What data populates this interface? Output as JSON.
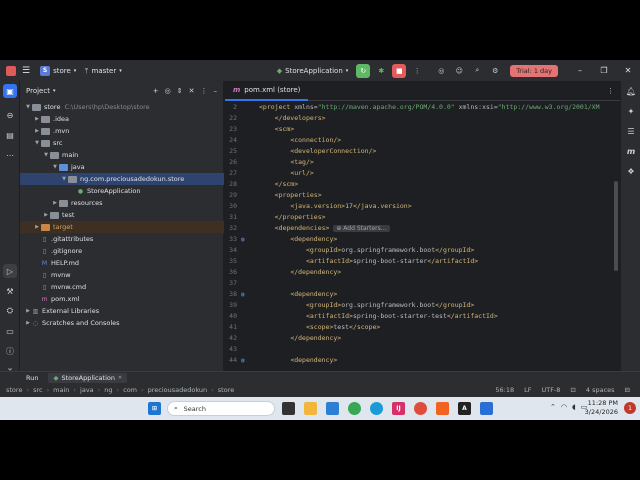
{
  "titlebar": {
    "project_badge": "S",
    "project_name": "store",
    "branch": "master",
    "run_config": "StoreApplication",
    "trial_label": "Trial: 1 day"
  },
  "project_panel": {
    "title": "Project",
    "tree": [
      {
        "label": "store",
        "extra": "C:\\Users\\hp\\Desktop\\store",
        "depth": 0,
        "arrow": "open",
        "icon": "folder"
      },
      {
        "label": ".idea",
        "depth": 1,
        "arrow": "closed",
        "icon": "folder"
      },
      {
        "label": ".mvn",
        "depth": 1,
        "arrow": "closed",
        "icon": "folder"
      },
      {
        "label": "src",
        "depth": 1,
        "arrow": "open",
        "icon": "folder"
      },
      {
        "label": "main",
        "depth": 2,
        "arrow": "open",
        "icon": "folder"
      },
      {
        "label": "java",
        "depth": 3,
        "arrow": "open",
        "icon": "folder-blue"
      },
      {
        "label": "ng.com.preciousadedokun.store",
        "depth": 4,
        "arrow": "open",
        "icon": "folder",
        "selected": true
      },
      {
        "label": "StoreApplication",
        "depth": 5,
        "arrow": "",
        "icon": "class"
      },
      {
        "label": "resources",
        "depth": 3,
        "arrow": "closed",
        "icon": "folder"
      },
      {
        "label": "test",
        "depth": 2,
        "arrow": "closed",
        "icon": "folder"
      },
      {
        "label": "target",
        "depth": 1,
        "arrow": "closed",
        "icon": "folder-orange",
        "excluded": true
      },
      {
        "label": ".gitattributes",
        "depth": 1,
        "arrow": "",
        "icon": "file"
      },
      {
        "label": ".gitignore",
        "depth": 1,
        "arrow": "",
        "icon": "file"
      },
      {
        "label": "HELP.md",
        "depth": 1,
        "arrow": "",
        "icon": "md"
      },
      {
        "label": "mvnw",
        "depth": 1,
        "arrow": "",
        "icon": "file"
      },
      {
        "label": "mvnw.cmd",
        "depth": 1,
        "arrow": "",
        "icon": "file"
      },
      {
        "label": "pom.xml",
        "depth": 1,
        "arrow": "",
        "icon": "maven"
      },
      {
        "label": "External Libraries",
        "depth": 0,
        "arrow": "closed",
        "icon": "lib"
      },
      {
        "label": "Scratches and Consoles",
        "depth": 0,
        "arrow": "closed",
        "icon": "scratch"
      }
    ]
  },
  "editor": {
    "tab_prefix": "m",
    "tab_label": "pom.xml (store)",
    "lines": [
      {
        "n": "2",
        "html": "<span class='tag'>&lt;project</span> <span class='attr'>xmlns=</span><span class='val'>\"http://maven.apache.org/POM/4.0.0\"</span> <span class='attr'>xmlns:xsi=</span><span class='val'>\"http://www.w3.org/2001/XM</span>"
      },
      {
        "n": "22",
        "html": "    <span class='tag'>&lt;/developers&gt;</span>"
      },
      {
        "n": "23",
        "html": "    <span class='tag'>&lt;scm&gt;</span>"
      },
      {
        "n": "24",
        "html": "        <span class='tag'>&lt;connection/&gt;</span>"
      },
      {
        "n": "25",
        "html": "        <span class='tag'>&lt;developerConnection/&gt;</span>"
      },
      {
        "n": "26",
        "html": "        <span class='tag'>&lt;tag/&gt;</span>"
      },
      {
        "n": "27",
        "html": "        <span class='tag'>&lt;url/&gt;</span>"
      },
      {
        "n": "28",
        "html": "    <span class='tag'>&lt;/scm&gt;</span>"
      },
      {
        "n": "29",
        "html": "    <span class='tag'>&lt;properties&gt;</span>"
      },
      {
        "n": "30",
        "html": "        <span class='tag'>&lt;java.version&gt;</span>17<span class='tag'>&lt;/java.version&gt;</span>"
      },
      {
        "n": "31",
        "html": "    <span class='tag'>&lt;/properties&gt;</span>"
      },
      {
        "n": "32",
        "html": "    <span class='tag'>&lt;dependencies&gt;</span> <span class='hint'>⊕ Add Starters...</span>"
      },
      {
        "n": "33",
        "html": "        <span class='tag'>&lt;dependency&gt;</span>",
        "gutter": true
      },
      {
        "n": "34",
        "html": "            <span class='tag'>&lt;groupId&gt;</span>org.springframework.boot<span class='tag'>&lt;/groupId&gt;</span>"
      },
      {
        "n": "35",
        "html": "            <span class='tag'>&lt;artifactId&gt;</span>spring-boot-starter<span class='tag'>&lt;/artifactId&gt;</span>"
      },
      {
        "n": "36",
        "html": "        <span class='tag'>&lt;/dependency&gt;</span>"
      },
      {
        "n": "37",
        "html": ""
      },
      {
        "n": "38",
        "html": "        <span class='tag'>&lt;dependency&gt;</span>",
        "gutter": true
      },
      {
        "n": "39",
        "html": "            <span class='tag'>&lt;groupId&gt;</span>org.springframework.boot<span class='tag'>&lt;/groupId&gt;</span>"
      },
      {
        "n": "40",
        "html": "            <span class='tag'>&lt;artifactId&gt;</span>spring-boot-starter-test<span class='tag'>&lt;/artifactId&gt;</span>"
      },
      {
        "n": "41",
        "html": "            <span class='tag'>&lt;scope&gt;</span>test<span class='tag'>&lt;/scope&gt;</span>"
      },
      {
        "n": "42",
        "html": "        <span class='tag'>&lt;/dependency&gt;</span>"
      },
      {
        "n": "43",
        "html": ""
      },
      {
        "n": "44",
        "html": "        <span class='tag'>&lt;dependency&gt;</span>",
        "gutter": true
      }
    ]
  },
  "runbar": {
    "run_label": "Run",
    "run_tab": "StoreApplication"
  },
  "statusbar": {
    "breadcrumb": [
      "store",
      "src",
      "main",
      "java",
      "ng",
      "com",
      "preciousadedokun",
      "store"
    ],
    "position": "56:18",
    "line_sep": "LF",
    "encoding": "UTF-8",
    "indent": "4 spaces"
  },
  "taskbar": {
    "search_placeholder": "Search",
    "time": "11:28 PM",
    "date": "3/24/2026",
    "notif_count": "1"
  },
  "colors": {
    "accent": "#3574f0",
    "run_green": "#5fb865",
    "stop_red": "#e55b5b",
    "trial": "#e57373"
  }
}
